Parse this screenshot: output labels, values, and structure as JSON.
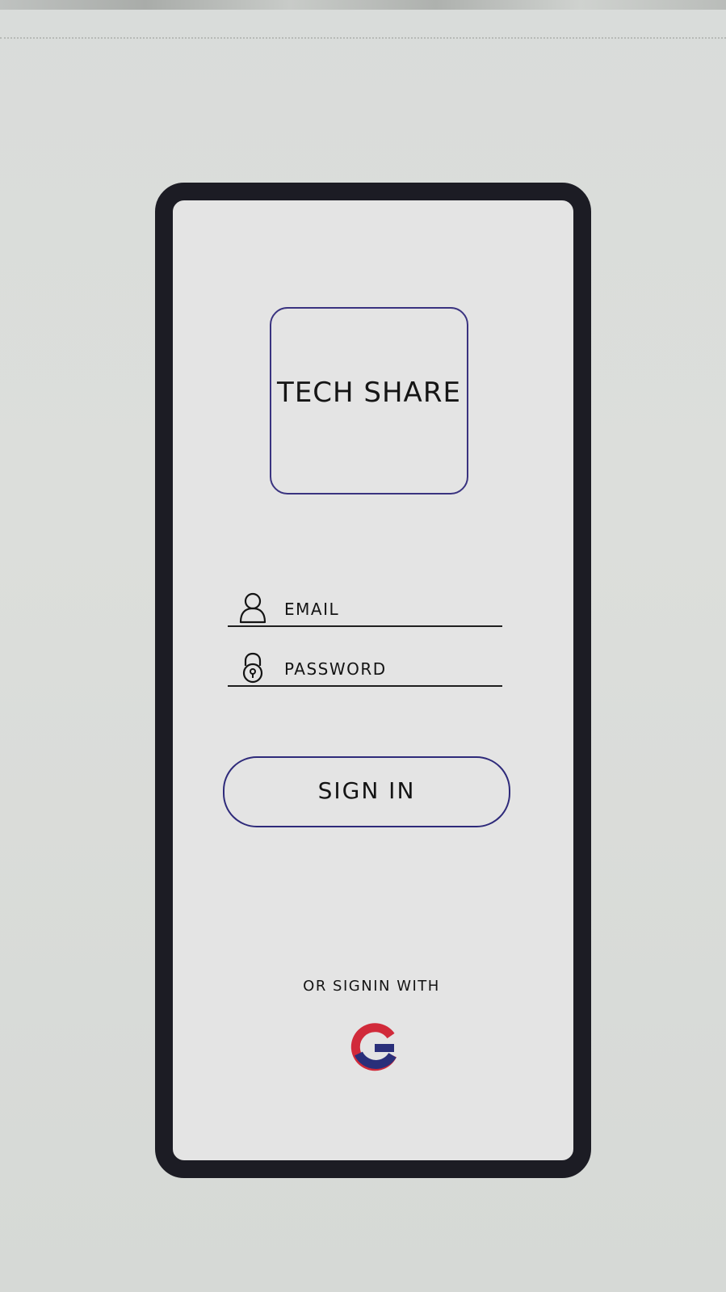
{
  "app": {
    "logo_text": "TECH SHARE"
  },
  "login": {
    "email_placeholder": "EMAIL",
    "password_placeholder": "PASSWORD",
    "signin_label": "SIGN IN",
    "alt_signin_text": "OR SIGNIN WITH"
  },
  "icons": {
    "email": "user-icon",
    "password": "lock-icon",
    "google": "google-icon"
  },
  "colors": {
    "frame": "#1c1c24",
    "ink_blue": "#3a3380",
    "google_red": "#d12a3a",
    "google_blue": "#2a2f7a"
  }
}
